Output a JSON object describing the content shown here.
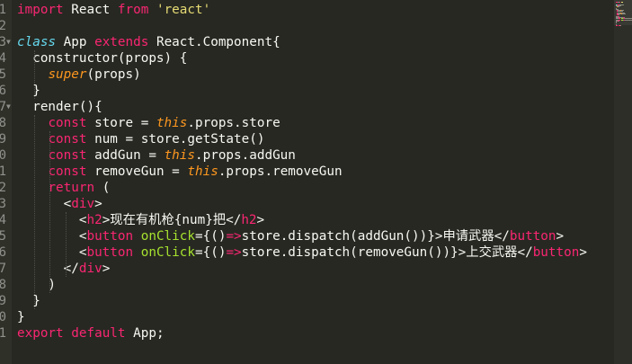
{
  "editor": {
    "theme_colors": {
      "background": "#272822",
      "text": "#f8f8f2",
      "keyword": "#f92672",
      "string": "#e6db74",
      "storage": "#66d9ef",
      "this": "#fd971f",
      "attribute": "#a6e22e",
      "gutter_text": "#8f908a"
    },
    "line_numbers": [
      "1",
      "2",
      "3",
      "4",
      "5",
      "6",
      "7",
      "8",
      "9",
      "10",
      "11",
      "12",
      "13",
      "14",
      "15",
      "16",
      "17",
      "18",
      "19",
      "20",
      "21"
    ],
    "fold_markers": [
      "",
      "",
      "▼",
      "",
      "",
      "",
      "▼",
      "",
      "",
      "",
      "",
      "",
      "",
      "",
      "",
      "",
      "",
      "",
      "",
      "",
      ""
    ],
    "lines": [
      [
        [
          "kw",
          "import"
        ],
        [
          "plain",
          " React "
        ],
        [
          "kw",
          "from"
        ],
        [
          "plain",
          " "
        ],
        [
          "str",
          "'react'"
        ]
      ],
      [],
      [
        [
          "stor",
          "class"
        ],
        [
          "plain",
          " App "
        ],
        [
          "kw",
          "extends"
        ],
        [
          "plain",
          " React.Component{"
        ]
      ],
      [
        [
          "plain",
          "  constructor(props) {"
        ]
      ],
      [
        [
          "plain",
          "    "
        ],
        [
          "sup",
          "super"
        ],
        [
          "plain",
          "(props)"
        ]
      ],
      [
        [
          "plain",
          "  }"
        ]
      ],
      [
        [
          "plain",
          "  render(){"
        ]
      ],
      [
        [
          "plain",
          "    "
        ],
        [
          "kw",
          "const"
        ],
        [
          "plain",
          " store = "
        ],
        [
          "this",
          "this"
        ],
        [
          "plain",
          ".props.store"
        ]
      ],
      [
        [
          "plain",
          "    "
        ],
        [
          "kw",
          "const"
        ],
        [
          "plain",
          " num = store.getState()"
        ]
      ],
      [
        [
          "plain",
          "    "
        ],
        [
          "kw",
          "const"
        ],
        [
          "plain",
          " addGun = "
        ],
        [
          "this",
          "this"
        ],
        [
          "plain",
          ".props.addGun"
        ]
      ],
      [
        [
          "plain",
          "    "
        ],
        [
          "kw",
          "const"
        ],
        [
          "plain",
          " removeGun = "
        ],
        [
          "this",
          "this"
        ],
        [
          "plain",
          ".props.removeGun"
        ]
      ],
      [
        [
          "plain",
          "    "
        ],
        [
          "kw",
          "return"
        ],
        [
          "plain",
          " ("
        ]
      ],
      [
        [
          "plain",
          "      <"
        ],
        [
          "tag",
          "div"
        ],
        [
          "plain",
          ">"
        ]
      ],
      [
        [
          "plain",
          "        <"
        ],
        [
          "tag",
          "h2"
        ],
        [
          "plain",
          ">现在有机枪{num}把</"
        ],
        [
          "tag",
          "h2"
        ],
        [
          "plain",
          ">"
        ]
      ],
      [
        [
          "plain",
          "        <"
        ],
        [
          "tag",
          "button"
        ],
        [
          "plain",
          " "
        ],
        [
          "attr",
          "onClick"
        ],
        [
          "plain",
          "={()"
        ],
        [
          "op",
          "=>"
        ],
        [
          "plain",
          "store.dispatch(addGun())}>申请武器</"
        ],
        [
          "tag",
          "button"
        ],
        [
          "plain",
          ">"
        ]
      ],
      [
        [
          "plain",
          "        <"
        ],
        [
          "tag",
          "button"
        ],
        [
          "plain",
          " "
        ],
        [
          "attr",
          "onClick"
        ],
        [
          "plain",
          "={()"
        ],
        [
          "op",
          "=>"
        ],
        [
          "plain",
          "store.dispatch(removeGun())}>上交武器</"
        ],
        [
          "tag",
          "button"
        ],
        [
          "plain",
          ">"
        ]
      ],
      [
        [
          "plain",
          "      </"
        ],
        [
          "tag",
          "div"
        ],
        [
          "plain",
          ">"
        ]
      ],
      [
        [
          "plain",
          "    )"
        ]
      ],
      [
        [
          "plain",
          "  }"
        ]
      ],
      [
        [
          "plain",
          "}"
        ]
      ],
      [
        [
          "kw",
          "export"
        ],
        [
          "plain",
          " "
        ],
        [
          "kw",
          "default"
        ],
        [
          "plain",
          " App;"
        ]
      ]
    ]
  }
}
